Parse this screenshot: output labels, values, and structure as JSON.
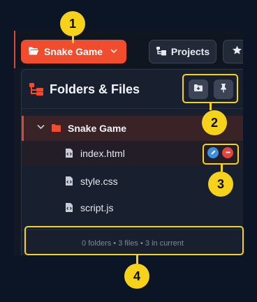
{
  "topbar": {
    "project_button": "Snake Game",
    "projects_button": "Projects"
  },
  "panel": {
    "title": "Folders & Files",
    "folder": {
      "name": "Snake Game"
    },
    "files": [
      {
        "name": "index.html"
      },
      {
        "name": "style.css"
      },
      {
        "name": "script.js"
      }
    ],
    "footer": "0 folders • 3 files • 3 in current"
  },
  "annotations": [
    "1",
    "2",
    "3",
    "4"
  ],
  "colors": {
    "accent": "#f04d2f",
    "highlight": "#f6d31a",
    "edit": "#3b8fdc",
    "delete": "#e0463f"
  },
  "icons": {
    "project_button": "folder-open-icon",
    "projects_button": "folder-tree-icon",
    "star_button": "star-icon",
    "new_folder": "folder-plus-icon",
    "pin": "pin-icon",
    "file": "code-file-icon",
    "edit": "pencil-icon",
    "delete": "minus-icon"
  }
}
